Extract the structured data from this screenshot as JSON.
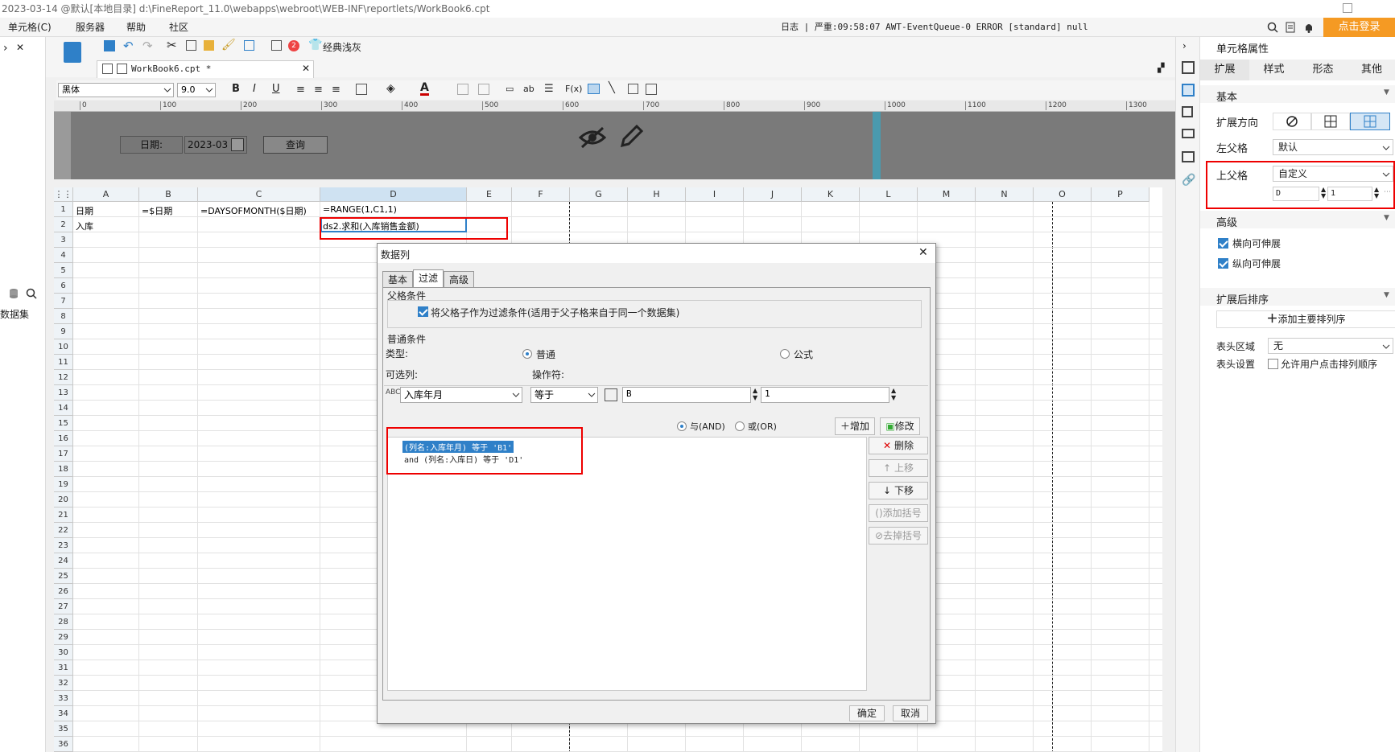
{
  "window": {
    "title": "2023-03-14 @默认[本地目录]    d:\\FineReport_11.0\\webapps\\webroot\\WEB-INF\\reportlets/WorkBook6.cpt"
  },
  "menu": {
    "items": [
      "单元格(C)",
      "服务器",
      "帮助",
      "社区"
    ],
    "log_text": "日志 | 严重:09:58:07 AWT-EventQueue-0 ERROR [standard] null",
    "login_label": "点击登录"
  },
  "toolbar": {
    "classic_label": "经典浅灰",
    "badge_count": "2",
    "font_family": "黑体",
    "font_size": "9.0",
    "file_tab": "WorkBook6.cpt *"
  },
  "left_panel": {
    "dataset_label": "数据集"
  },
  "param_form": {
    "date_label": "日期:",
    "date_value": "2023-03",
    "query_button": "查询"
  },
  "ruler": {
    "ticks": [
      "0",
      "100",
      "200",
      "300",
      "400",
      "500",
      "600",
      "700",
      "800",
      "900",
      "1000",
      "1100",
      "1200",
      "1300"
    ]
  },
  "grid": {
    "columns": [
      "A",
      "B",
      "C",
      "D",
      "E",
      "F",
      "G",
      "H",
      "I",
      "J",
      "K",
      "L",
      "M",
      "N",
      "O",
      "P"
    ],
    "rows": [
      "1",
      "2",
      "3",
      "4",
      "5",
      "6",
      "7",
      "8",
      "9",
      "10",
      "11",
      "12",
      "13",
      "14",
      "15",
      "16",
      "17",
      "18",
      "19",
      "20",
      "21",
      "22",
      "23",
      "24",
      "25",
      "26",
      "27",
      "28",
      "29",
      "30",
      "31",
      "32",
      "33",
      "34",
      "35",
      "36"
    ],
    "cells": {
      "A1": "日期",
      "B1": "=$日期",
      "C1": "=DAYSOFMONTH($日期)",
      "D1": "=RANGE(1,C1,1)",
      "A2": "入库",
      "D2": "ds2.求和(入库销售金额)"
    }
  },
  "dialog": {
    "title": "数据列",
    "tabs": [
      "基本",
      "过滤",
      "高级"
    ],
    "parent_section": "父格条件",
    "parent_checkbox": "将父格子作为过滤条件(适用于父子格来自于同一个数据集)",
    "normal_section": "普通条件",
    "type_label": "类型:",
    "type_normal": "普通",
    "type_formula": "公式",
    "column_label": "可选列:",
    "operator_label": "操作符:",
    "column_value": "入库年月",
    "operator_value": "等于",
    "value1": "B",
    "value2": "1",
    "and_label": "与(AND)",
    "or_label": "或(OR)",
    "add_button": "增加",
    "modify_button": "修改",
    "conditions": [
      "(列名:入库年月) 等于 'B1'",
      "and (列名:入库日) 等于 'D1'"
    ],
    "delete_button": "删除",
    "up_button": "上移",
    "down_button": "下移",
    "add_bracket": "添加括号",
    "remove_bracket": "去掉括号",
    "ok_button": "确定",
    "cancel_button": "取消"
  },
  "properties": {
    "header": "单元格属性",
    "tabs": [
      "扩展",
      "样式",
      "形态",
      "其他"
    ],
    "basic_section": "基本",
    "direction_label": "扩展方向",
    "left_parent_label": "左父格",
    "left_parent_value": "默认",
    "up_parent_label": "上父格",
    "up_parent_value": "自定义",
    "up_parent_col": "D",
    "up_parent_row": "1",
    "advanced_section": "高级",
    "h_stretch": "横向可伸展",
    "v_stretch": "纵向可伸展",
    "sort_section": "扩展后排序",
    "add_sort": "添加主要排列序",
    "header_area_label": "表头区域",
    "header_area_value": "无",
    "header_setting_label": "表头设置",
    "allow_sort_label": "允许用户点击排列顺序"
  },
  "colors": {
    "accent": "#2f80c8",
    "highlight_red": "#e00000",
    "login_orange": "#f59a23",
    "param_bg": "#7a7a7a",
    "teal_line": "#4a9aae"
  }
}
